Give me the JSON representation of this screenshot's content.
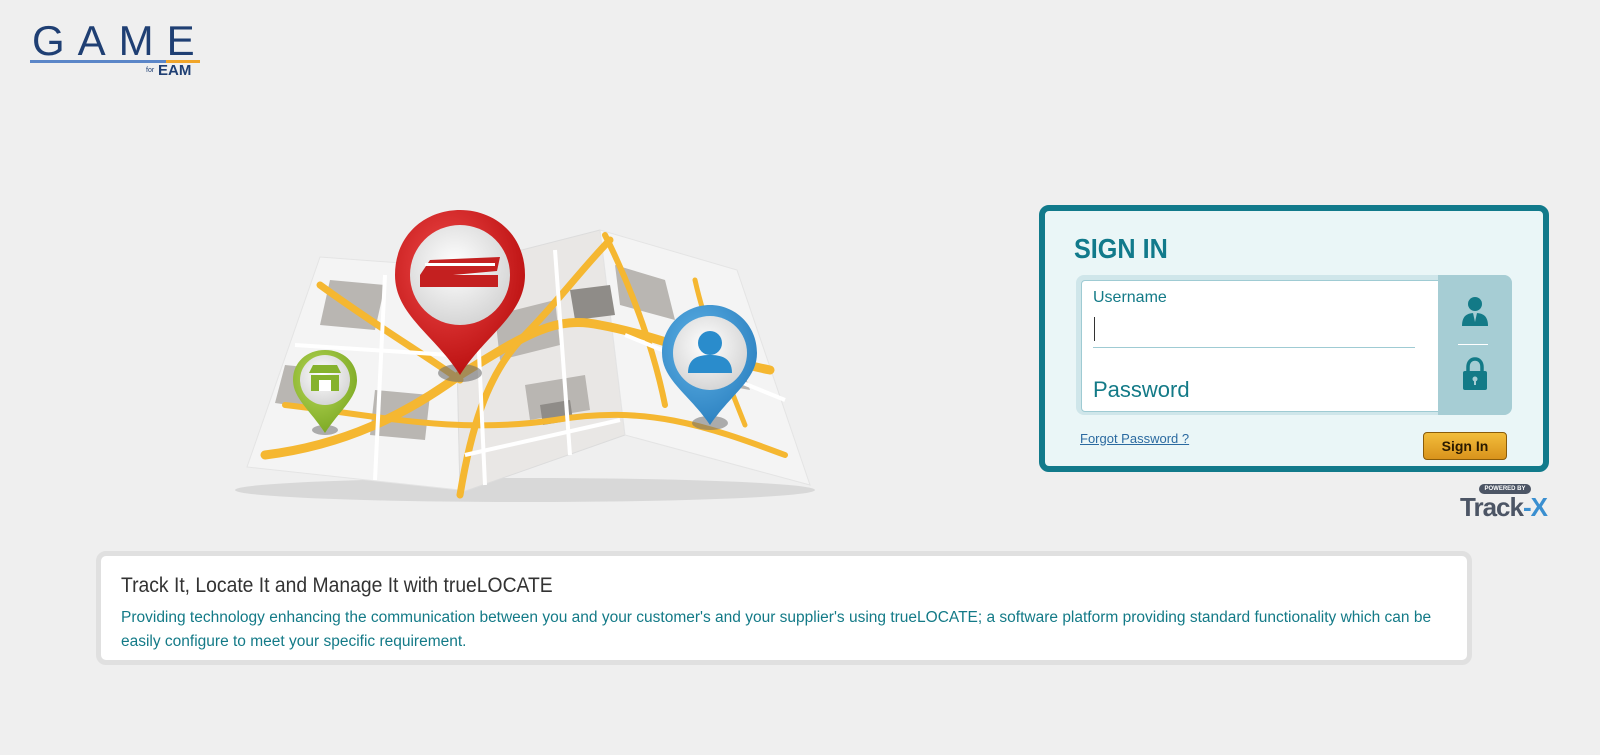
{
  "logo": {
    "word": "GAME",
    "for": "for",
    "sub": "EAM"
  },
  "signin": {
    "title": "SIGN IN",
    "username_label": "Username",
    "username_value": "",
    "password_placeholder": "Password",
    "forgot_label": "Forgot Password ?",
    "button_label": "Sign In",
    "icons": [
      "user-icon",
      "lock-icon"
    ]
  },
  "powered": {
    "badge": "POWERED BY",
    "brand_main": "Track",
    "brand_x": "-X"
  },
  "info": {
    "title": "Track It, Locate It and Manage It with trueLOCATE",
    "text": "Providing technology enhancing the communication between you and your customer's and your supplier's using trueLOCATE; a software platform providing standard functionality which can be easily configure to meet your specific requirement."
  },
  "colors": {
    "accent": "#117a8b",
    "button": "#e0a12a",
    "logo": "#1f3f73"
  }
}
